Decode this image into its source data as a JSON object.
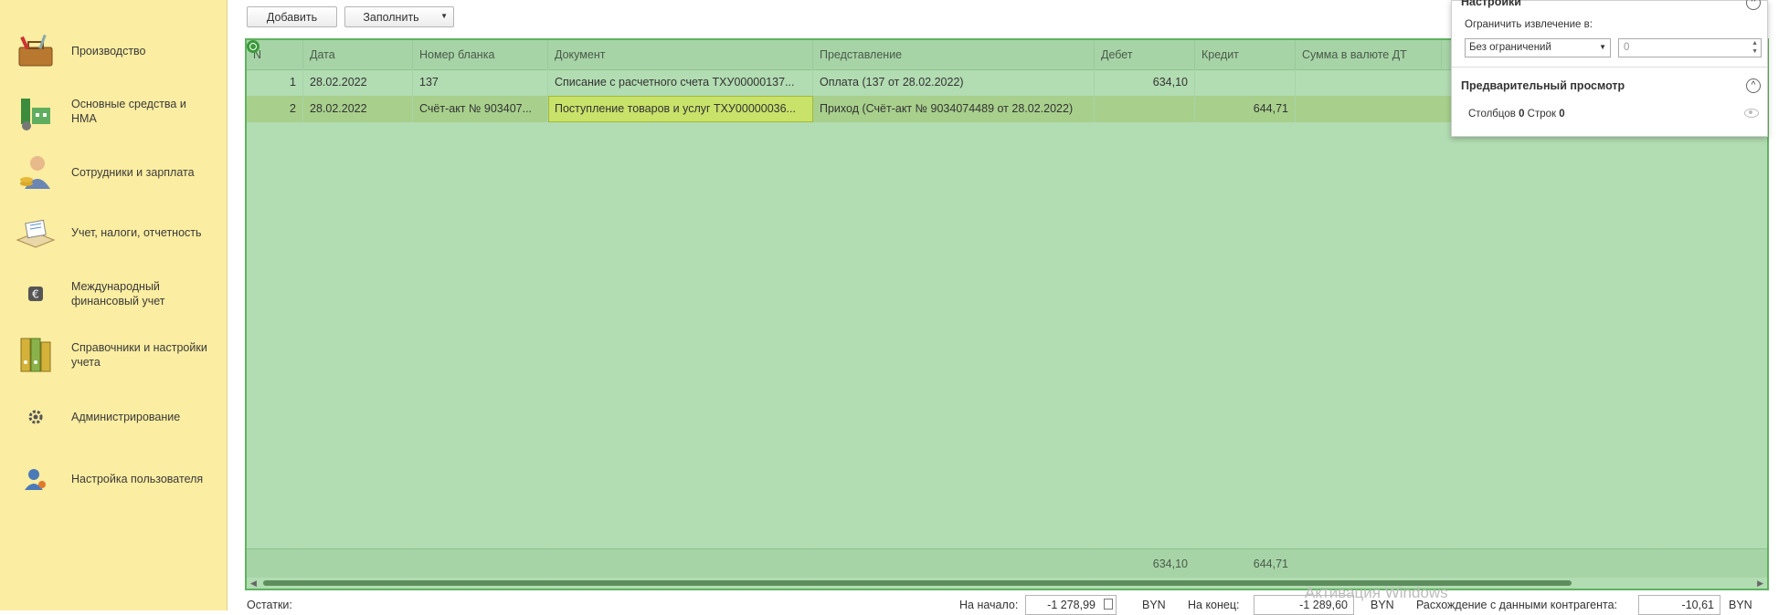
{
  "sidebar": {
    "items": [
      {
        "label": "Производство",
        "icon": "toolbox-icon"
      },
      {
        "label": "Основные средства и НМА",
        "icon": "factory-icon"
      },
      {
        "label": "Сотрудники и зарплата",
        "icon": "employee-icon"
      },
      {
        "label": "Учет, налоги, отчетность",
        "icon": "report-icon"
      },
      {
        "label": "Международный финансовый учет",
        "icon": "euro-icon"
      },
      {
        "label": "Справочники и настройки учета",
        "icon": "binders-icon"
      },
      {
        "label": "Администрирование",
        "icon": "gear-icon"
      },
      {
        "label": "Настройка пользователя",
        "icon": "user-settings-icon"
      }
    ]
  },
  "toolbar": {
    "add_label": "Добавить",
    "fill_label": "Заполнить"
  },
  "table": {
    "columns": [
      "N",
      "Дата",
      "Номер бланка",
      "Документ",
      "Представление",
      "Дебет",
      "Кредит",
      "Сумма в валюте ДТ"
    ],
    "rows": [
      {
        "n": "1",
        "date": "28.02.2022",
        "blank": "137",
        "doc": "Списание с расчетного счета ТХУ00000137...",
        "repr": "Оплата (137 от 28.02.2022)",
        "debit": "634,10",
        "credit": ""
      },
      {
        "n": "2",
        "date": "28.02.2022",
        "blank": "Счёт-акт № 903407...",
        "doc": "Поступление товаров и услуг ТХУ00000036...",
        "repr": "Приход (Счёт-акт № 9034074489 от 28.02.2022)",
        "debit": "",
        "credit": "644,71"
      }
    ],
    "totals": {
      "debit": "634,10",
      "credit": "644,71"
    }
  },
  "settings": {
    "title": "Настройки",
    "limit_label": "Ограничить извлечение в:",
    "limit_select": "Без ограничений",
    "limit_value": "0",
    "preview_title": "Предварительный просмотр",
    "columns_label": "Столбцов",
    "columns_count": "0",
    "rows_label": "Строк",
    "rows_count": "0"
  },
  "status": {
    "balances_label": "Остатки:",
    "start_label": "На начало:",
    "start_value": "-1 278,99",
    "end_label": "На конец:",
    "end_value": "-1 289,60",
    "currency": "BYN",
    "diff_label": "Расхождение с данными контрагента:",
    "diff_value": "-10,61"
  },
  "watermark": "Активация Windows",
  "colors": {
    "sidebar": "#fbeda1",
    "table_bg": "#b2dcb2",
    "table_border": "#5fb35f",
    "selected_row": "#a8d08c"
  }
}
